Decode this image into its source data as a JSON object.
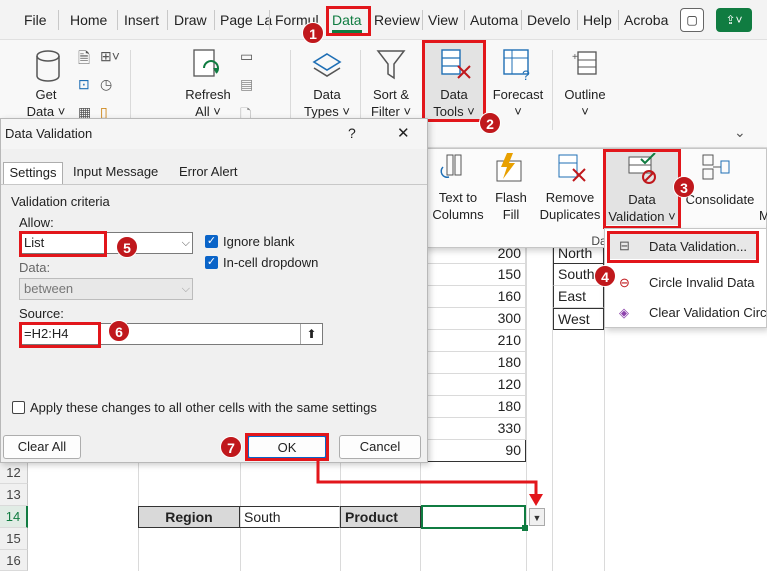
{
  "menubar": {
    "tabs": [
      "File",
      "Home",
      "Insert",
      "Draw",
      "Page La",
      "Formul",
      "Data",
      "Review",
      "View",
      "Automa",
      "Develo",
      "Help",
      "Acroba"
    ]
  },
  "ribbon": {
    "get_data": "Get\nData ˅",
    "refresh_all": "Refresh\nAll ˅",
    "data_types": "Data\nTypes ˅",
    "sort_filter": "Sort &\nFilter ˅",
    "data_tools": "Data\nTools ˅",
    "forecast": "Forecast\n˅",
    "outline": "Outline\n˅"
  },
  "data_tools_panel": {
    "text_to_columns": "Text to\nColumns",
    "flash_fill": "Flash\nFill",
    "remove_duplicates": "Remove\nDuplicates",
    "data_validation": "Data\nValidation ˅",
    "consolidate": "Consolidate",
    "group_label": "Da",
    "extra": "M"
  },
  "validation_menu": {
    "items": [
      "Data Validation...",
      "Circle Invalid Data",
      "Clear Validation Circ"
    ]
  },
  "dialog": {
    "title": "Data Validation",
    "help": "?",
    "close": "✕",
    "tabs": [
      "Settings",
      "Input Message",
      "Error Alert"
    ],
    "criteria_label": "Validation criteria",
    "allow_label": "Allow:",
    "allow_value": "List",
    "ignore_blank": "Ignore blank",
    "in_cell_dropdown": "In-cell dropdown",
    "data_label": "Data:",
    "data_value": "between",
    "source_label": "Source:",
    "source_value": "=H2:H4",
    "apply_all": "Apply these changes to all other cells with the same settings",
    "clear_all": "Clear All",
    "ok": "OK",
    "cancel": "Cancel"
  },
  "sheet": {
    "values": [
      "200",
      "150",
      "160",
      "300",
      "210",
      "180",
      "120",
      "180",
      "330",
      "90"
    ],
    "regions": [
      "North",
      "South",
      "East",
      "West"
    ],
    "row_numbers": [
      "12",
      "13",
      "14",
      "15",
      "16"
    ],
    "row14": {
      "region_label": "Region",
      "region_value": "South",
      "product_label": "Product"
    }
  },
  "callouts": [
    "1",
    "2",
    "3",
    "4",
    "5",
    "6",
    "7"
  ],
  "colors": {
    "accent": "#107c41",
    "highlight": "#e2161b",
    "badge": "#c0181c",
    "checkbox": "#0a64c8"
  }
}
